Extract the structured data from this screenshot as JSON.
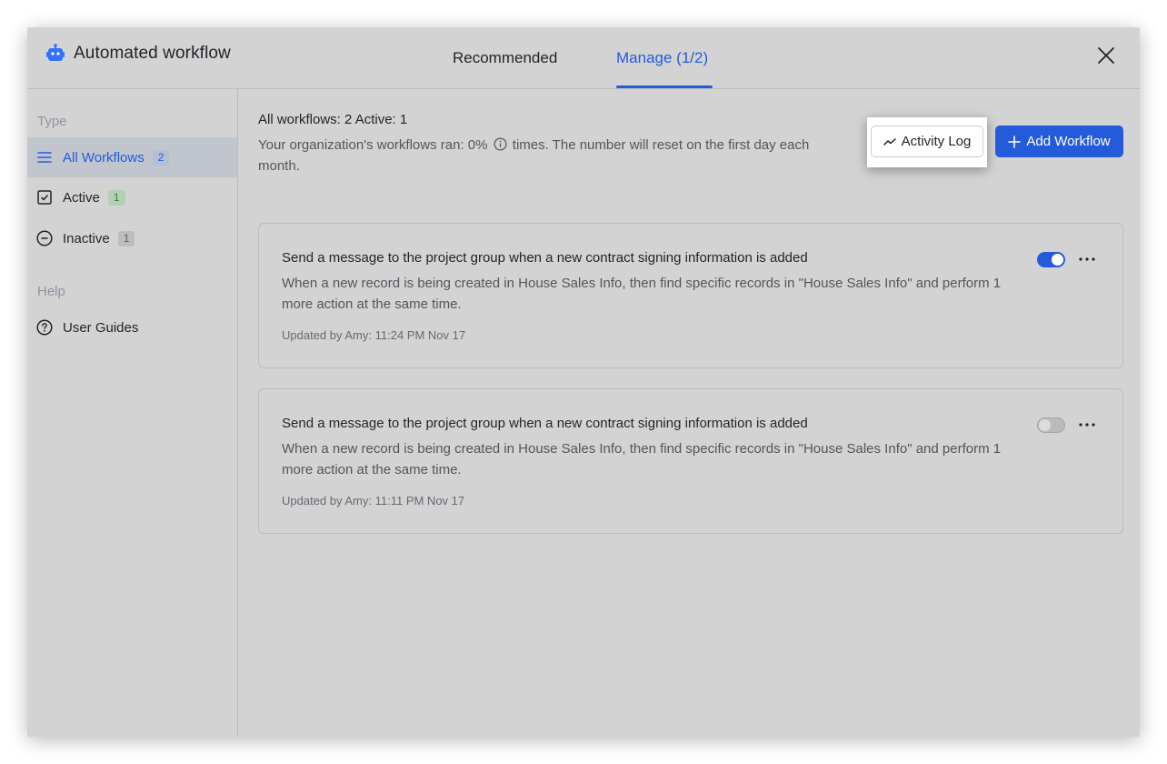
{
  "header": {
    "title": "Automated workflow",
    "tabs": [
      {
        "label": "Recommended",
        "active": false
      },
      {
        "label": "Manage (1/2)",
        "active": true
      }
    ]
  },
  "sidebar": {
    "type_section": "Type",
    "items": [
      {
        "label": "All Workflows",
        "count": "2",
        "icon": "list-icon",
        "active": true
      },
      {
        "label": "Active",
        "count": "1",
        "icon": "checkbox-icon",
        "active": false
      },
      {
        "label": "Inactive",
        "count": "1",
        "icon": "minus-circle-icon",
        "active": false
      }
    ],
    "help_section": "Help",
    "help_items": [
      {
        "label": "User Guides",
        "icon": "question-circle-icon"
      }
    ]
  },
  "main": {
    "summary": "All workflows: 2 Active: 1",
    "note_before": "Your organization's workflows ran: 0%",
    "note_after": "times. The number will reset on the first day each month.",
    "activity_log_label": "Activity Log",
    "add_workflow_label": "Add Workflow",
    "workflows": [
      {
        "title": "Send a message to the project group when a new contract signing information is added",
        "description": "When a new record is being created in House Sales Info, then find specific records in \"House Sales Info\" and perform 1 more action at the same time.",
        "meta": "Updated by Amy: 11:24 PM Nov 17",
        "enabled": true
      },
      {
        "title": "Send a message to the project group when a new contract signing information is added",
        "description": "When a new record is being created in House Sales Info, then find specific records in \"House Sales Info\" and perform 1 more action at the same time.",
        "meta": "Updated by Amy: 11:11 PM Nov 17",
        "enabled": false
      }
    ]
  },
  "colors": {
    "accent": "#245bdb",
    "background": "#d3d3d3",
    "active_badge": "#2e8b3a"
  }
}
